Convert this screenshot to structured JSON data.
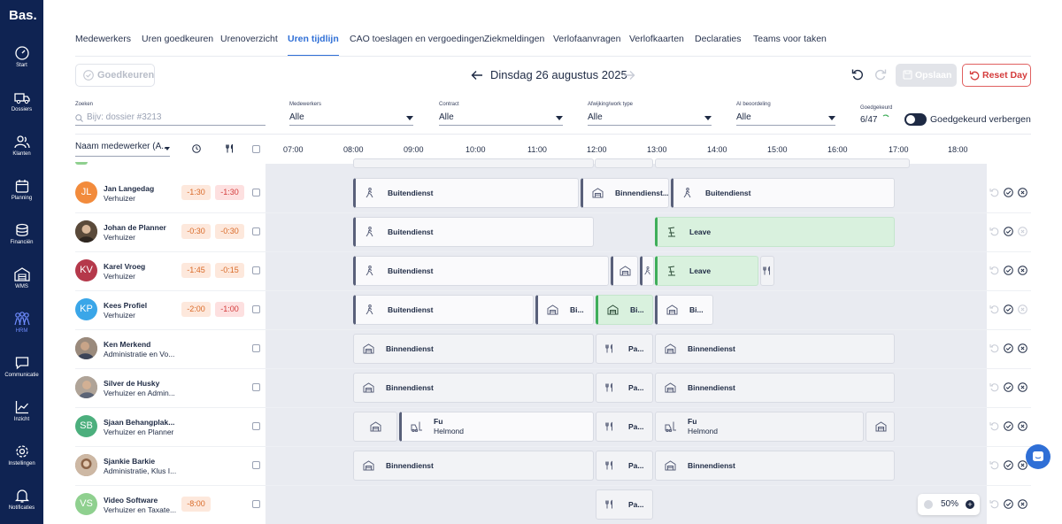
{
  "app": {
    "logo": "Bas."
  },
  "sidebar": {
    "items": [
      {
        "label": "Start",
        "icon": "gauge-icon"
      },
      {
        "label": "Dossiers",
        "icon": "truck-icon"
      },
      {
        "label": "Klanten",
        "icon": "users-icon"
      },
      {
        "label": "Planning",
        "icon": "calendar-icon"
      },
      {
        "label": "Financiën",
        "icon": "coins-icon"
      },
      {
        "label": "WMS",
        "icon": "warehouse-icon"
      },
      {
        "label": "HRM",
        "icon": "team-icon",
        "active": true
      },
      {
        "label": "Communicatie",
        "icon": "chat-icon"
      },
      {
        "label": "Inzicht",
        "icon": "chart-icon"
      },
      {
        "label": "Instellingen",
        "icon": "gear-icon"
      },
      {
        "label": "Notificaties",
        "icon": "bell-icon"
      }
    ]
  },
  "tabs": [
    {
      "label": "Medewerkers"
    },
    {
      "label": "Uren goedkeuren"
    },
    {
      "label": "Urenoverzicht"
    },
    {
      "label": "Uren tijdlijn",
      "active": true
    },
    {
      "label": "CAO toeslagen en vergoedingen"
    },
    {
      "label": "Ziekmeldingen"
    },
    {
      "label": "Verlofaanvragen"
    },
    {
      "label": "Verlofkaarten"
    },
    {
      "label": "Declaraties"
    },
    {
      "label": "Teams voor taken"
    }
  ],
  "toolbar": {
    "approve_label": "Goedkeuren",
    "date": "Dinsdag 26 augustus 2025",
    "save_label": "Opslaan",
    "reset_label": "Reset Day"
  },
  "filters": {
    "search": {
      "label": "Zoeken",
      "placeholder": "Bijv: dossier #3213"
    },
    "employees": {
      "label": "Medewerkers",
      "value": "Alle"
    },
    "contract": {
      "label": "Contract",
      "value": "Alle"
    },
    "deviation": {
      "label": "Afwijking/work type",
      "value": "Alle"
    },
    "ai": {
      "label": "AI beoordeling",
      "value": "Alle"
    },
    "approved": {
      "label": "Goedgekeurd",
      "value": "6/47"
    },
    "hide_approved_label": "Goedgekeurd verbergen"
  },
  "table": {
    "name_column": "Naam medewerker (A...",
    "hours": [
      "07:00",
      "08:00",
      "09:00",
      "10:00",
      "11:00",
      "12:00",
      "13:00",
      "14:00",
      "15:00",
      "16:00",
      "17:00",
      "18:00"
    ]
  },
  "employees": [
    {
      "initials": "JL",
      "avatar_color": "#f28b3c",
      "name": "Jan Langedag",
      "role": "Verhuizer",
      "diff1": "-1:30",
      "diff2": "-1:30"
    },
    {
      "initials": "",
      "avatar_color": "#6b5a48",
      "name": "Johan de Planner",
      "role": "Verhuizer",
      "diff1": "-0:30",
      "diff2": "-0:30"
    },
    {
      "initials": "KV",
      "avatar_color": "#b5394b",
      "name": "Karel Vroeg",
      "role": "Verhuizer",
      "diff1": "-1:45",
      "diff2": "-0:15"
    },
    {
      "initials": "KP",
      "avatar_color": "#3aa6e8",
      "name": "Kees Profiel",
      "role": "Verhuizer",
      "diff1": "-2:00",
      "diff2": "-1:00"
    },
    {
      "initials": "",
      "avatar_color": "#7a6a5c",
      "name": "Ken Merkend",
      "role": "Administratie en Vo...",
      "diff1": "",
      "diff2": ""
    },
    {
      "initials": "",
      "avatar_color": "#8a7f74",
      "name": "Silver de Husky",
      "role": "Verhuizer en Admin...",
      "diff1": "",
      "diff2": ""
    },
    {
      "initials": "SB",
      "avatar_color": "#4caf7d",
      "name": "Sjaan Behangplak...",
      "role": "Verhuizer en Planner",
      "diff1": "",
      "diff2": ""
    },
    {
      "initials": "",
      "avatar_color": "#9a7b66",
      "name": "Sjankie Barkie",
      "role": "Administratie, Klus I...",
      "diff1": "",
      "diff2": ""
    },
    {
      "initials": "VS",
      "avatar_color": "#8fd08f",
      "name": "Video Software",
      "role": "Verhuizer en Taxate...",
      "diff1": "-8:00",
      "diff2": ""
    }
  ],
  "blocks": {
    "buitendienst": "Buitendienst",
    "binnendienst": "Binnendienst",
    "binnendienst_short": "Binnendienst...",
    "leave": "Leave",
    "bi": "Bi...",
    "pa": "Pa...",
    "fu": "Fu",
    "helmond": "Helmond"
  },
  "zoom": {
    "value": "50%"
  },
  "colors": {
    "accent": "#2f6fd6",
    "sidebar": "#0f2352",
    "danger": "#d43c3c",
    "leave": "#d9f1de"
  }
}
